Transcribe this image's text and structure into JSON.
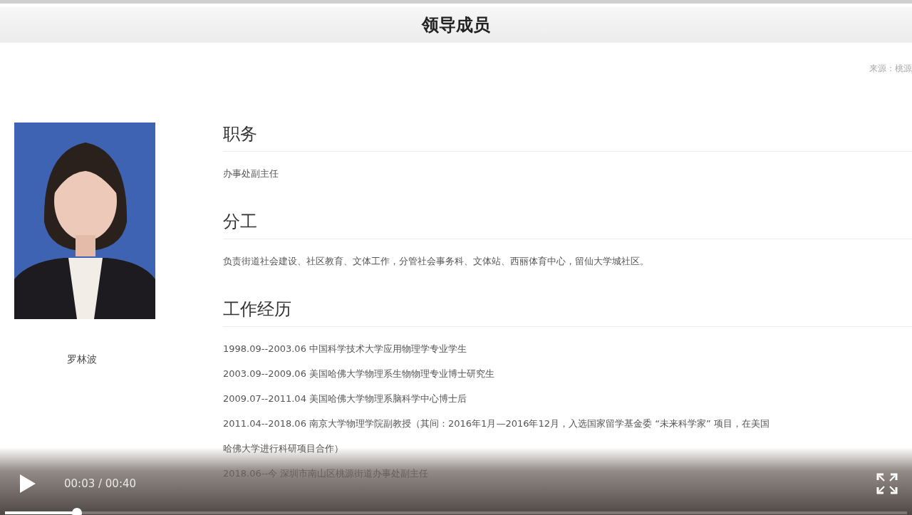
{
  "page": {
    "title": "领导成员",
    "source": "来源：桃源"
  },
  "profile": {
    "name": "罗林波"
  },
  "sections": [
    {
      "heading": "职务",
      "lines": [
        "办事处副主任"
      ]
    },
    {
      "heading": "分工",
      "lines": [
        "负责街道社会建设、社区教育、文体工作，分管社会事务科、文体站、西丽体育中心，留仙大学城社区。"
      ]
    },
    {
      "heading": "工作经历",
      "lines": [
        "1998.09--2003.06 中国科学技术大学应用物理学专业学生",
        "2003.09--2009.06 美国哈佛大学物理系生物物理专业博士研究生",
        "2009.07--2011.04 美国哈佛大学物理系脑科学中心博士后",
        "2011.04--2018.06 南京大学物理学院副教授（其间：2016年1月—2016年12月，入选国家留学基金委 “未来科学家” 项目，在美国",
        "哈佛大学进行科研项目合作）",
        "2018.06--今 深圳市南山区桃源街道办事处副主任"
      ]
    }
  ],
  "player": {
    "time": "00:03 / 00:40",
    "level": 0.08
  }
}
